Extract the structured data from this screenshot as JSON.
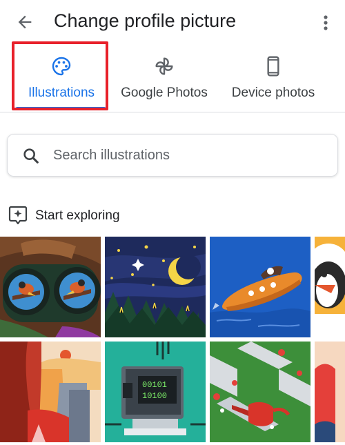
{
  "header": {
    "title": "Change profile picture"
  },
  "tabs": [
    {
      "label": "Illustrations",
      "icon": "palette-icon",
      "active": true
    },
    {
      "label": "Google Photos",
      "icon": "pinwheel-icon",
      "active": false
    },
    {
      "label": "Device photos",
      "icon": "phone-icon",
      "active": false
    }
  ],
  "search": {
    "placeholder": "Search illustrations",
    "value": ""
  },
  "section": {
    "label": "Start exploring",
    "icon": "sparkle-frame-icon"
  },
  "tiles": [
    {
      "name": "binoculars-birds"
    },
    {
      "name": "night-moon-forest"
    },
    {
      "name": "submarine-ocean"
    },
    {
      "name": "penguin-orange"
    },
    {
      "name": "canyon-sunset"
    },
    {
      "name": "retro-computer"
    },
    {
      "name": "garden-watering-can"
    },
    {
      "name": "red-mountain"
    }
  ],
  "colors": {
    "accent": "#1a73e8",
    "highlight": "#e8202a",
    "text": "#202124",
    "secondary": "#5f6368"
  }
}
